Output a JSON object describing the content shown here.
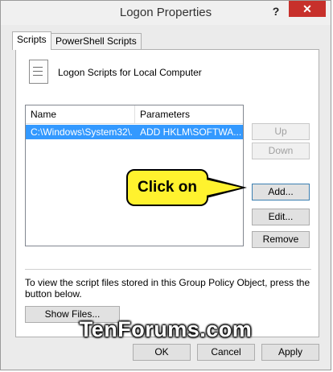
{
  "window": {
    "title": "Logon Properties",
    "help": "?",
    "close": "✕"
  },
  "tabs": [
    {
      "label": "Scripts",
      "active": true
    },
    {
      "label": "PowerShell Scripts",
      "active": false
    }
  ],
  "panel": {
    "icon": "script-icon",
    "heading": "Logon Scripts for Local Computer"
  },
  "list": {
    "columns": [
      "Name",
      "Parameters"
    ],
    "rows": [
      {
        "name": "C:\\Windows\\System32\\...",
        "params": "ADD HKLM\\SOFTWA...",
        "selected": true
      }
    ]
  },
  "side_buttons": {
    "up": "Up",
    "down": "Down",
    "add": "Add...",
    "edit": "Edit...",
    "remove": "Remove"
  },
  "description": "To view the script files stored in this Group Policy Object, press the button below.",
  "show_files": "Show Files...",
  "footer": {
    "ok": "OK",
    "cancel": "Cancel",
    "apply": "Apply"
  },
  "callout": "Click on",
  "watermark": "TenForums.com",
  "colors": {
    "selection": "#3399ff",
    "close_button": "#c7302b",
    "callout": "#fff22e"
  }
}
